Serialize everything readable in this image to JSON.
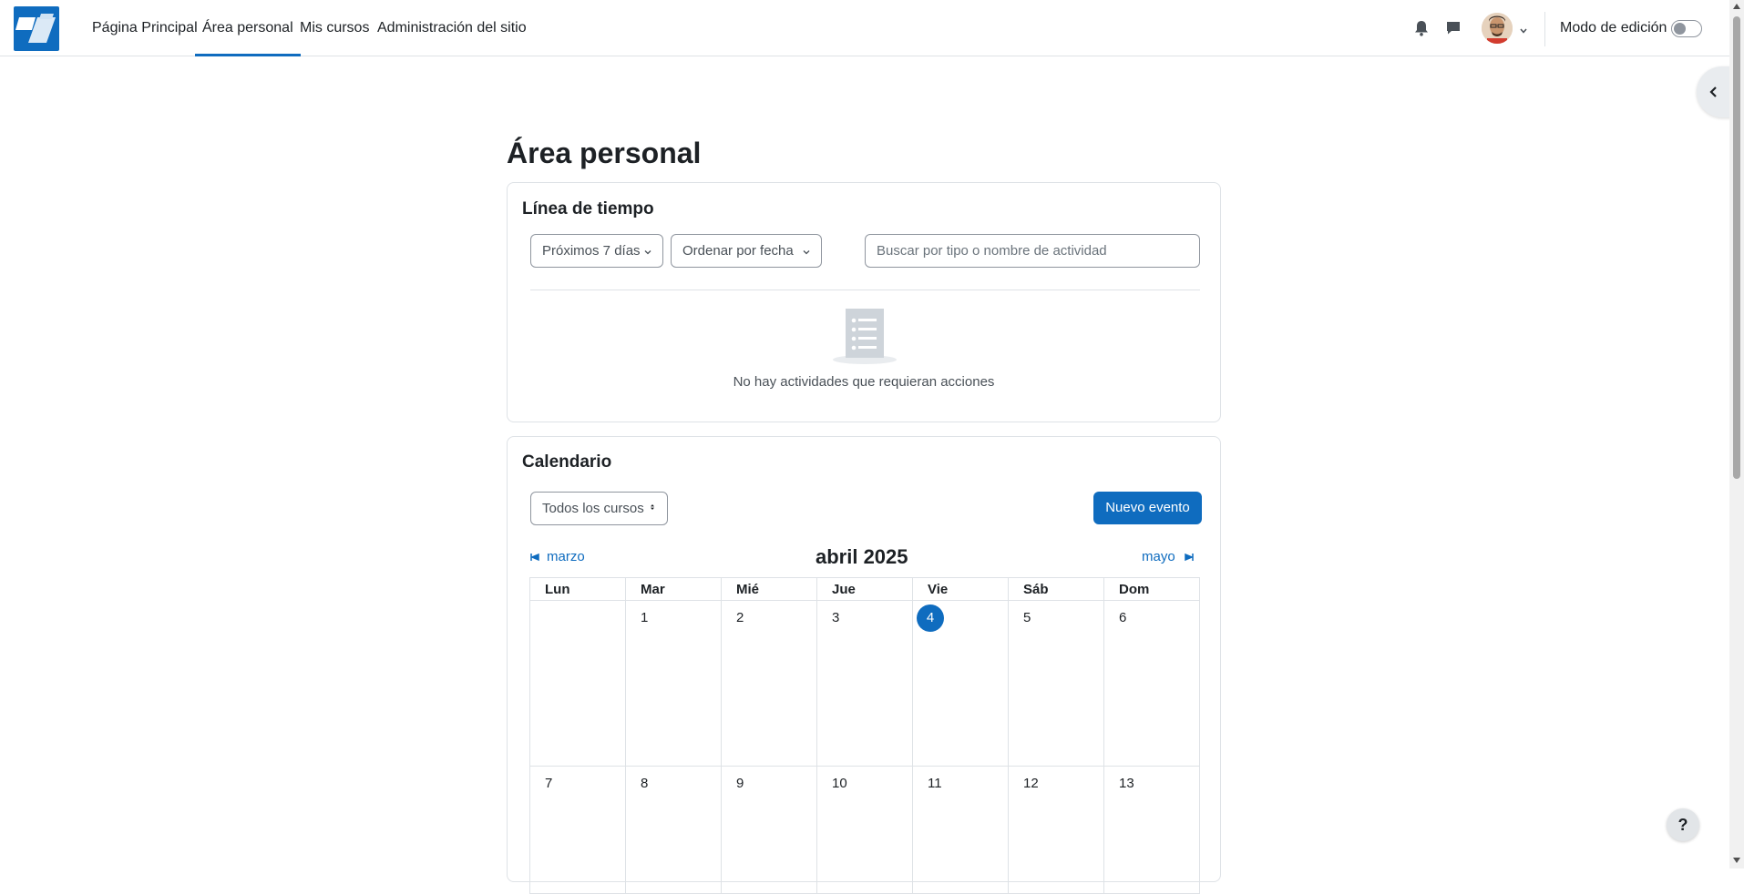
{
  "nav": {
    "items": [
      {
        "label": "Página Principal"
      },
      {
        "label": "Área personal"
      },
      {
        "label": "Mis cursos"
      },
      {
        "label": "Administración del sitio"
      }
    ],
    "edit_mode_label": "Modo de edición",
    "icons": [
      "bell-icon",
      "chat-icon"
    ],
    "accent": "#0f6cbf"
  },
  "page": {
    "title": "Área personal"
  },
  "timeline": {
    "title": "Línea de tiempo",
    "filter_label": "Próximos 7 días",
    "sort_label": "Ordenar por fecha",
    "search_placeholder": "Buscar por tipo o nombre de actividad",
    "empty_text": "No hay actividades que requieran acciones"
  },
  "calendar": {
    "title": "Calendario",
    "course_filter": "Todos los cursos",
    "new_event": "Nuevo evento",
    "prev_month": "marzo",
    "next_month": "mayo",
    "month_title": "abril 2025",
    "weekdays": [
      "Lun",
      "Mar",
      "Mié",
      "Jue",
      "Vie",
      "Sáb",
      "Dom"
    ],
    "week1": [
      "",
      "1",
      "2",
      "3",
      "4",
      "5",
      "6"
    ],
    "week2": [
      "7",
      "8",
      "9",
      "10",
      "11",
      "12",
      "13"
    ],
    "today": "4"
  },
  "help_label": "?"
}
